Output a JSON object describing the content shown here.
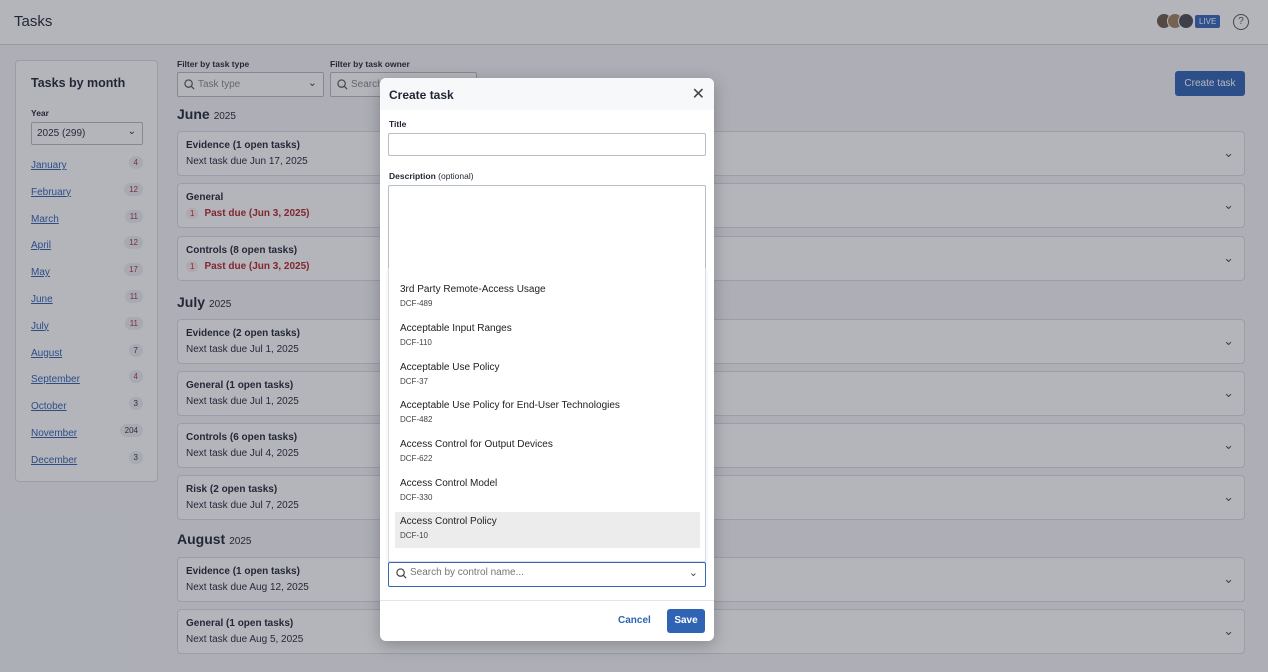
{
  "app": {
    "title": "Tasks",
    "live_label": "LIVE",
    "help_glyph": "?"
  },
  "sidebar": {
    "heading": "Tasks by month",
    "year_label": "Year",
    "year_value": "2025 (299)",
    "months": [
      {
        "name": "January",
        "count": "4"
      },
      {
        "name": "February",
        "count": "12"
      },
      {
        "name": "March",
        "count": "11"
      },
      {
        "name": "April",
        "count": "12"
      },
      {
        "name": "May",
        "count": "17"
      },
      {
        "name": "June",
        "count": "11"
      },
      {
        "name": "July",
        "count": "11"
      },
      {
        "name": "August",
        "count": "7"
      },
      {
        "name": "September",
        "count": "4"
      },
      {
        "name": "October",
        "count": "3"
      },
      {
        "name": "November",
        "count": "204"
      },
      {
        "name": "December",
        "count": "3"
      }
    ]
  },
  "filters": {
    "type_label": "Filter by task type",
    "type_placeholder": "Task type",
    "owner_label": "Filter by task owner",
    "owner_placeholder": "Search"
  },
  "create_button": "Create task",
  "sections": [
    {
      "month": "June",
      "year": "2025",
      "cards": [
        {
          "title": "Evidence (1 open tasks)",
          "sub": "Next task due Jun 17, 2025"
        },
        {
          "title": "General",
          "badge": "1",
          "past_due": "Past due (Jun 3, 2025)"
        },
        {
          "title": "Controls (8 open tasks)",
          "badge": "1",
          "past_due": "Past due (Jun 3, 2025)"
        }
      ]
    },
    {
      "month": "July",
      "year": "2025",
      "cards": [
        {
          "title": "Evidence (2 open tasks)",
          "sub": "Next task due Jul 1, 2025"
        },
        {
          "title": "General (1 open tasks)",
          "sub": "Next task due Jul 1, 2025"
        },
        {
          "title": "Controls (6 open tasks)",
          "sub": "Next task due Jul 4, 2025"
        },
        {
          "title": "Risk (2 open tasks)",
          "sub": "Next task due Jul 7, 2025"
        }
      ]
    },
    {
      "month": "August",
      "year": "2025",
      "cards": [
        {
          "title": "Evidence (1 open tasks)",
          "sub": "Next task due Aug 12, 2025"
        },
        {
          "title": "General (1 open tasks)",
          "sub": "Next task due Aug 5, 2025"
        }
      ]
    }
  ],
  "modal": {
    "title": "Create task",
    "title_label": "Title",
    "desc_label": "Description",
    "desc_optional": "(optional)",
    "control_placeholder": "Search by control name...",
    "options": [
      {
        "name": "3rd Party Remote-Access Usage",
        "code": "DCF-489"
      },
      {
        "name": "Acceptable Input Ranges",
        "code": "DCF-110"
      },
      {
        "name": "Acceptable Use Policy",
        "code": "DCF-37"
      },
      {
        "name": "Acceptable Use Policy for End-User Technologies",
        "code": "DCF-482"
      },
      {
        "name": "Access Control for Output Devices",
        "code": "DCF-622"
      },
      {
        "name": "Access Control Model",
        "code": "DCF-330"
      },
      {
        "name": "Access Control Policy",
        "code": "DCF-10"
      }
    ],
    "cancel": "Cancel",
    "save": "Save"
  }
}
